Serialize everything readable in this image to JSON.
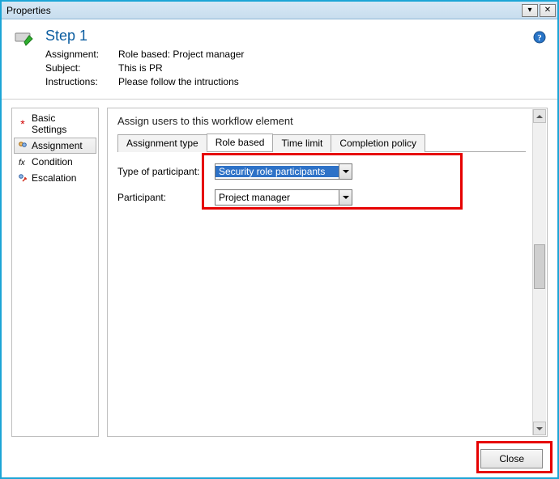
{
  "window": {
    "title": "Properties"
  },
  "header": {
    "step_title": "Step 1",
    "rows": {
      "assignment_label": "Assignment:",
      "assignment_value": "Role based: Project manager",
      "subject_label": "Subject:",
      "subject_value": "This is PR",
      "instructions_label": "Instructions:",
      "instructions_value": "Please follow the intructions"
    }
  },
  "sidebar": {
    "items": [
      {
        "label": "Basic Settings"
      },
      {
        "label": "Assignment"
      },
      {
        "label": "Condition"
      },
      {
        "label": "Escalation"
      }
    ]
  },
  "main": {
    "section_title": "Assign users to this workflow element",
    "tabs": [
      {
        "label": "Assignment type"
      },
      {
        "label": "Role based"
      },
      {
        "label": "Time limit"
      },
      {
        "label": "Completion policy"
      }
    ],
    "form": {
      "type_label": "Type of participant:",
      "type_value": "Security role participants",
      "participant_label": "Participant:",
      "participant_value": "Project manager"
    }
  },
  "footer": {
    "close_label": "Close"
  }
}
